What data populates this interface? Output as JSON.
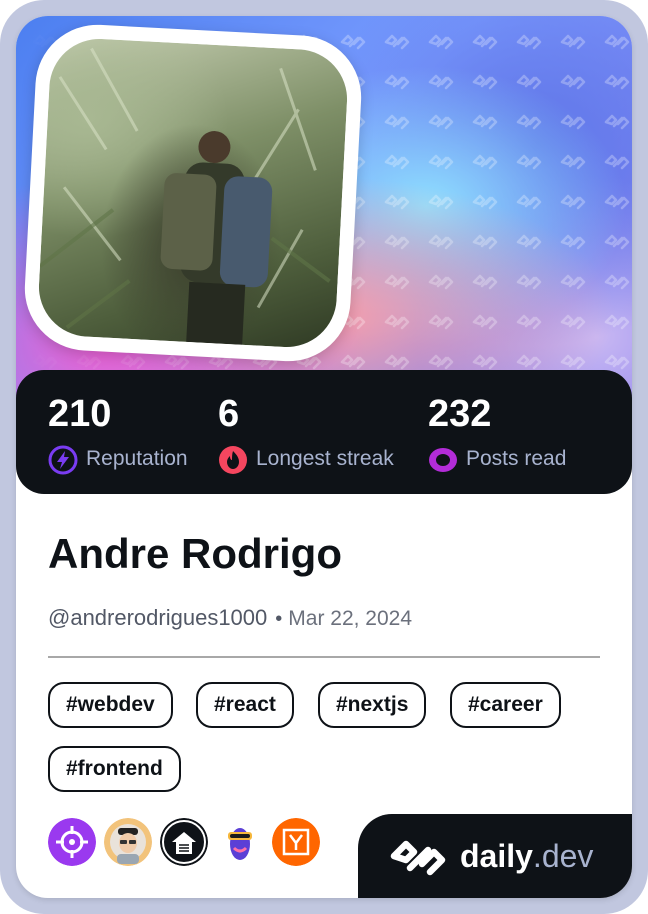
{
  "profile": {
    "name": "Andre Rodrigo",
    "handle": "@andrerodrigues1000",
    "separator": "•",
    "joined": "Mar 22, 2024"
  },
  "stats": [
    {
      "value": "210",
      "label": "Reputation",
      "icon": "reputation-lightning-icon",
      "color": "#7a3cf2"
    },
    {
      "value": "6",
      "label": "Longest streak",
      "icon": "streak-flame-icon",
      "color": "#f5465f"
    },
    {
      "value": "232",
      "label": "Posts read",
      "icon": "posts-read-eye-icon",
      "color": "#b32cd8"
    }
  ],
  "tags": [
    "#webdev",
    "#react",
    "#nextjs",
    "#career",
    "#frontend"
  ],
  "badges": [
    {
      "name": "crosshair-squad-icon",
      "color": "#9a39ef"
    },
    {
      "name": "memoji-avatar-icon",
      "color": "#f2c37b"
    },
    {
      "name": "server-squad-icon",
      "color": "#0e1217"
    },
    {
      "name": "vr-head-icon",
      "color": "#5b3fd6"
    },
    {
      "name": "ycombinator-icon",
      "color": "#ff6600"
    }
  ],
  "brand": {
    "name": "daily",
    "tld": ".dev"
  },
  "colors": {
    "card_frame": "#c1c7df",
    "stats_bg": "#0e1217",
    "label": "#a8b3cf",
    "text": "#0e1217"
  }
}
